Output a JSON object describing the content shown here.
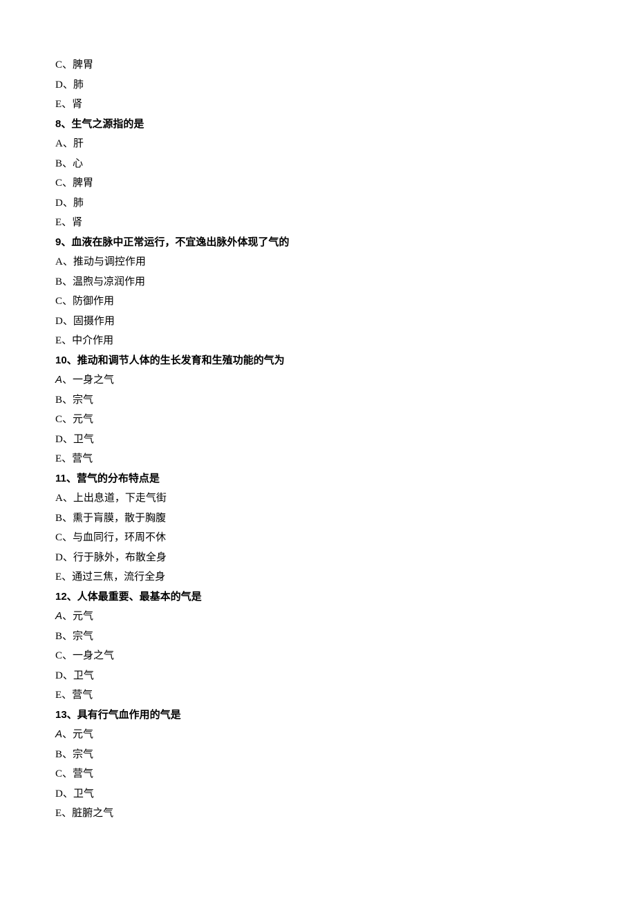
{
  "lines": [
    {
      "cls": "option",
      "text": "C、脾胃"
    },
    {
      "cls": "option",
      "text": "D、肺"
    },
    {
      "cls": "option",
      "text": "E、肾"
    },
    {
      "cls": "question",
      "text": "8、生气之源指的是"
    },
    {
      "cls": "option",
      "text": "A、肝"
    },
    {
      "cls": "option",
      "text": "B、心"
    },
    {
      "cls": "option",
      "text": "C、脾胃"
    },
    {
      "cls": "option",
      "text": "D、肺"
    },
    {
      "cls": "option",
      "text": "E、肾"
    },
    {
      "cls": "question",
      "text": "9、血液在脉中正常运行，不宜逸出脉外体现了气的"
    },
    {
      "cls": "option",
      "text": "A、推动与调控作用"
    },
    {
      "cls": "option",
      "text": "B、温煦与凉润作用"
    },
    {
      "cls": "option",
      "text": "C、防御作用"
    },
    {
      "cls": "option",
      "text": "D、固摄作用"
    },
    {
      "cls": "option",
      "text": "E、中介作用"
    },
    {
      "cls": "question",
      "text": "10、推动和调节人体的生长发育和生殖功能的气为"
    },
    {
      "cls": "option",
      "altA": true,
      "text": "、一身之气"
    },
    {
      "cls": "option",
      "text": "B、宗气"
    },
    {
      "cls": "option",
      "text": "C、元气"
    },
    {
      "cls": "option",
      "text": "D、卫气"
    },
    {
      "cls": "option",
      "text": "E、营气"
    },
    {
      "cls": "question",
      "text": "11、营气的分布特点是"
    },
    {
      "cls": "option",
      "text": "A、上出息道，下走气街"
    },
    {
      "cls": "option",
      "text": "B、熏于肓膜，散于胸腹"
    },
    {
      "cls": "option",
      "text": "C、与血同行，环周不休"
    },
    {
      "cls": "option",
      "text": "D、行于脉外，布散全身"
    },
    {
      "cls": "option",
      "text": "E、通过三焦，流行全身"
    },
    {
      "cls": "question",
      "text": "12、人体最重要、最基本的气是"
    },
    {
      "cls": "option",
      "altA": true,
      "text": "、元气"
    },
    {
      "cls": "option",
      "text": "B、宗气"
    },
    {
      "cls": "option",
      "text": "C、一身之气"
    },
    {
      "cls": "option",
      "text": "D、卫气"
    },
    {
      "cls": "option",
      "text": "E、营气"
    },
    {
      "cls": "question",
      "text": "13、具有行气血作用的气是"
    },
    {
      "cls": "option",
      "altA": true,
      "text": "、元气"
    },
    {
      "cls": "option",
      "text": "B、宗气"
    },
    {
      "cls": "option",
      "text": "C、营气"
    },
    {
      "cls": "option",
      "text": "D、卫气"
    },
    {
      "cls": "option",
      "text": "E、脏腑之气"
    }
  ],
  "altA_char": "A"
}
